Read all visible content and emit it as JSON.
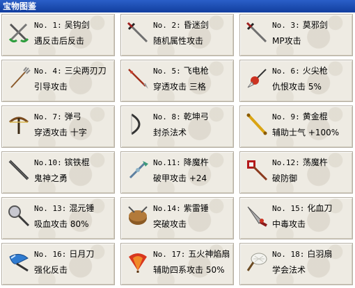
{
  "window": {
    "title": "宝物图鉴"
  },
  "items": [
    {
      "no": "No. 1:",
      "name": "吴钩剑",
      "effect": "遇反击后反击",
      "icon": "twin-swords-icon"
    },
    {
      "no": "No. 2:",
      "name": "昏迷剑",
      "effect": "随机属性攻击",
      "icon": "sword-icon"
    },
    {
      "no": "No. 3:",
      "name": "莫邪剑",
      "effect": "MP攻击",
      "icon": "sword-icon"
    },
    {
      "no": "No. 4:",
      "name": "三尖两刃刀",
      "effect": "引导攻击",
      "icon": "trident-icon"
    },
    {
      "no": "No. 5:",
      "name": "飞电枪",
      "effect": "穿透攻击 三格",
      "icon": "spear-icon"
    },
    {
      "no": "No. 6:",
      "name": "火尖枪",
      "effect": "仇恨攻击 5%",
      "icon": "fire-spear-icon"
    },
    {
      "no": "No. 7:",
      "name": "弹弓",
      "effect": "穿透攻击 十字",
      "icon": "crossbow-icon"
    },
    {
      "no": "No. 8:",
      "name": "乾坤弓",
      "effect": "封杀法术",
      "icon": "bow-icon"
    },
    {
      "no": "No. 9:",
      "name": "黄金棍",
      "effect": "辅助士气 +100%",
      "icon": "golden-staff-icon"
    },
    {
      "no": "No.10:",
      "name": "镔铁棍",
      "effect": "鬼神之勇",
      "icon": "iron-staff-icon"
    },
    {
      "no": "No.11:",
      "name": "降魔杵",
      "effect": "破甲攻击 +24",
      "icon": "vajra-icon"
    },
    {
      "no": "No.12:",
      "name": "荡魔杵",
      "effect": "破防御",
      "icon": "demon-pestle-icon"
    },
    {
      "no": "No. 13:",
      "name": "混元锤",
      "effect": "吸血攻击 80%",
      "icon": "mace-icon"
    },
    {
      "no": "No.14:",
      "name": "紫雷锤",
      "effect": "突破攻击",
      "icon": "war-drum-icon"
    },
    {
      "no": "No. 15:",
      "name": "化血刀",
      "effect": "中毒攻击",
      "icon": "blood-blade-icon"
    },
    {
      "no": "No. 16:",
      "name": "日月刀",
      "effect": "强化反击",
      "icon": "moon-blade-icon"
    },
    {
      "no": "No. 17:",
      "name": "五火神焰扇",
      "effect": "辅助四系攻击 50%",
      "icon": "flame-fan-icon"
    },
    {
      "no": "No. 18:",
      "name": "白羽扇",
      "effect": "学会法术",
      "icon": "feather-fan-icon"
    }
  ]
}
